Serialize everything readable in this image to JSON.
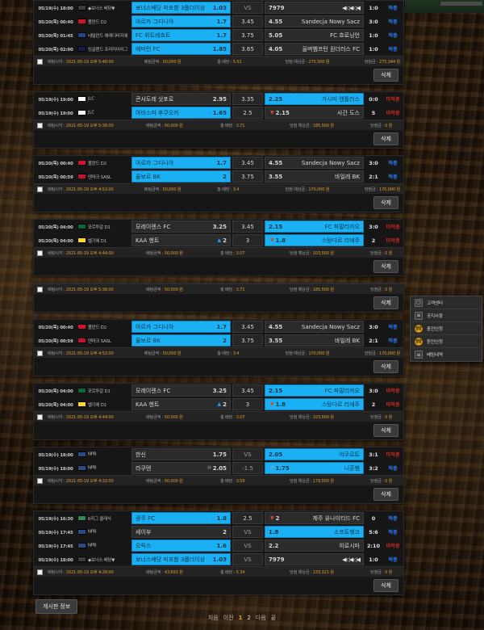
{
  "colors": {
    "selected": "#1ab0f3",
    "win": "#2f7cff",
    "lose": "#d0271b",
    "accent": "#d99c2b",
    "panel": "#161616"
  },
  "labels": {
    "delete": "삭제",
    "board_info": "게시판 정보",
    "vs": "VS",
    "bet_time": "배팅시각",
    "bet_amount": "배팅금액",
    "total_odds": "총 배당",
    "expected": "당첨 예상금",
    "payout": "당첨금",
    "win": "적중",
    "lose": "미적중"
  },
  "quick_menu": [
    {
      "icon": "chat-icon",
      "glyph": "▢",
      "label": "고객센터",
      "kind": "box"
    },
    {
      "icon": "notice-icon",
      "glyph": "≡",
      "label": "공지사항",
      "kind": "box"
    },
    {
      "icon": "deposit-icon",
      "glyph": "₩",
      "label": "충전신청",
      "kind": "coin"
    },
    {
      "icon": "withdraw-icon",
      "glyph": "₩",
      "label": "환전신청",
      "kind": "coin"
    },
    {
      "icon": "history-icon",
      "glyph": "≡",
      "label": "베팅내역",
      "kind": "box"
    }
  ],
  "pagination": {
    "first": "처음",
    "prev": "이전",
    "pages": [
      "1",
      "2"
    ],
    "current": "1",
    "next": "다음",
    "last": "끝"
  },
  "slips": [
    {
      "info": {
        "time": "배팅시각 : 2021-05-19 오후 5:46:00",
        "amount": "배팅금액 : 50,000 원",
        "odds": "총 배당 : 5.51",
        "expected": "당첨 예상금 : 275,500 원",
        "payout": "당첨금 : 275,344 원"
      },
      "legs": [
        {
          "date": "05/19(수) 18:00",
          "league": "◆보너스 배당▼",
          "flag": "#3c3c3c",
          "home": "보너스배당 미포함 3폴더이상",
          "home_odds": "1.03",
          "home_sel": true,
          "home_mark": "",
          "draw": "VS",
          "draw_plain": true,
          "away": "",
          "away_odds": "7979",
          "away_sel": false,
          "away_mark": "",
          "away_bars": true,
          "score": "1:0",
          "result": "적중",
          "won": true
        },
        {
          "date": "05/20(목) 00:40",
          "league": "폴란드 D2",
          "flag": "#d8112a",
          "home": "아르카 그디니아",
          "home_odds": "1.7",
          "home_sel": true,
          "home_mark": "",
          "draw": "3.45",
          "draw_plain": false,
          "away": "Sandecja Nowy Sacz",
          "away_odds": "4.55",
          "away_sel": false,
          "away_mark": "",
          "score": "3:0",
          "result": "적중",
          "won": true
        },
        {
          "date": "05/20(목) 01:45",
          "league": "네덜란드 에레디비지에",
          "flag": "#21468b",
          "home": "FC 위트레흐트",
          "home_odds": "1.7",
          "home_sel": true,
          "home_mark": "",
          "draw": "3.75",
          "draw_plain": false,
          "away": "FC 흐로닝언",
          "away_odds": "5.05",
          "away_sel": false,
          "away_mark": "",
          "score": "1:0",
          "result": "적중",
          "won": true
        },
        {
          "date": "05/20(목) 02:00",
          "league": "잉글랜드 프리미어리그",
          "flag": "#1a1a4a",
          "home": "에버턴 FC",
          "home_odds": "1.85",
          "home_sel": true,
          "home_mark": "",
          "draw": "3.65",
          "draw_plain": false,
          "away": "울버햄프턴 원더러스 FC",
          "away_odds": "4.05",
          "away_sel": false,
          "away_mark": "",
          "score": "1:0",
          "result": "적중",
          "won": true
        }
      ]
    },
    {
      "info": {
        "time": "배팅시각 : 2021-05-19 오후 5:36:00",
        "amount": "배팅금액 : 50,000 원",
        "odds": "총 배당 : 3.71",
        "expected": "당첨 예상금 : 185,500 원",
        "payout": "당첨금 : 0 원"
      },
      "legs": [
        {
          "date": "05/19(수) 19:00",
          "league": "JLC",
          "flag": "#ffffff",
          "home": "콘사도레 삿포로",
          "home_odds": "2.95",
          "home_sel": false,
          "home_mark": "",
          "draw": "3.35",
          "draw_plain": false,
          "away": "가시마 앤틀러스",
          "away_odds": "2.25",
          "away_sel": true,
          "away_mark": "",
          "score": "0:0",
          "result": "미적중",
          "won": false
        },
        {
          "date": "05/19(수) 19:00",
          "league": "JLC",
          "flag": "#ffffff",
          "home": "아비스파 후쿠오카",
          "home_odds": "1.65",
          "home_sel": true,
          "home_mark": "up",
          "draw": "2.5",
          "draw_plain": false,
          "away": "사간 도스",
          "away_odds": "2.15",
          "away_sel": false,
          "away_mark": "down",
          "score": "5",
          "result": "미적중",
          "won": false
        }
      ]
    },
    {
      "info": {
        "time": "배팅시각 : 2021-05-19 오후 4:52:00",
        "amount": "배팅금액 : 50,000 원",
        "odds": "총 배당 : 3.4",
        "expected": "당첨 예상금 : 170,000 원",
        "payout": "당첨금 : 170,000 원"
      },
      "legs": [
        {
          "date": "05/20(목) 00:40",
          "league": "폴란드 D2",
          "flag": "#d8112a",
          "home": "아르카 그디니아",
          "home_odds": "1.7",
          "home_sel": true,
          "home_mark": "",
          "draw": "3.45",
          "draw_plain": false,
          "away": "Sandecja Nowy Sacz",
          "away_odds": "4.55",
          "away_sel": false,
          "away_mark": "",
          "score": "3:0",
          "result": "적중",
          "won": true
        },
        {
          "date": "05/20(목) 00:59",
          "league": "덴마크 SASL",
          "flag": "#c8102e",
          "home": "올보르 BK",
          "home_odds": "2",
          "home_sel": true,
          "home_mark": "",
          "draw": "3.75",
          "draw_plain": false,
          "away": "바일레 BK",
          "away_odds": "3.55",
          "away_sel": false,
          "away_mark": "",
          "score": "2:1",
          "result": "적중",
          "won": true
        }
      ]
    },
    {
      "info": {
        "time": "배팅시각 : 2021-05-19 오후 4:44:00",
        "amount": "배팅금액 : 50,000 원",
        "odds": "총 배당 : 3.07",
        "expected": "당첨 예상금 : 103,500 원",
        "payout": "당첨금 : 0 원"
      },
      "legs": [
        {
          "date": "05/20(목) 04:00",
          "league": "포르투갈 D1",
          "flag": "#046a38",
          "home": "모레이렌스 FC",
          "home_odds": "3.25",
          "home_sel": false,
          "home_mark": "",
          "draw": "3.45",
          "draw_plain": false,
          "away": "FC 파말리카오",
          "away_odds": "2.15",
          "away_sel": true,
          "away_mark": "",
          "score": "3:0",
          "result": "미적중",
          "won": false
        },
        {
          "date": "05/20(목) 04:00",
          "league": "벨기에 D1",
          "flag": "#fdda25",
          "home": "KAA 헨트",
          "home_odds": "2",
          "home_sel": false,
          "home_mark": "up",
          "draw": "3",
          "draw_plain": false,
          "away": "스탕다르 리에주",
          "away_odds": "1.8",
          "away_sel": true,
          "away_mark": "down",
          "score": "2",
          "result": "미적중",
          "won": false
        }
      ]
    },
    {
      "info": {
        "time": "배팅시각 : 2021-05-19 오후 5:36:00",
        "amount": "배팅금액 : 50,000 원",
        "odds": "총 배당 : 3.71",
        "expected": "당첨 예상금 : 185,500 원",
        "payout": "당첨금 : 0 원"
      },
      "legs": []
    },
    {
      "info": {
        "time": "배팅시각 : 2021-05-19 오후 4:52:00",
        "amount": "배팅금액 : 50,000 원",
        "odds": "총 배당 : 3.4",
        "expected": "당첨 예상금 : 170,000 원",
        "payout": "당첨금 : 170,000 원"
      },
      "legs": [
        {
          "date": "05/20(목) 00:40",
          "league": "폴란드 D2",
          "flag": "#d8112a",
          "home": "아르카 그디니아",
          "home_odds": "1.7",
          "home_sel": true,
          "home_mark": "",
          "draw": "3.45",
          "draw_plain": false,
          "away": "Sandecja Nowy Sacz",
          "away_odds": "4.55",
          "away_sel": false,
          "away_mark": "",
          "score": "3:0",
          "result": "적중",
          "won": true
        },
        {
          "date": "05/20(목) 00:59",
          "league": "덴마크 SASL",
          "flag": "#c8102e",
          "home": "올보르 BK",
          "home_odds": "2",
          "home_sel": true,
          "home_mark": "",
          "draw": "3.75",
          "draw_plain": false,
          "away": "바일레 BK",
          "away_odds": "3.55",
          "away_sel": false,
          "away_mark": "",
          "score": "2:1",
          "result": "적중",
          "won": true
        }
      ]
    },
    {
      "info": {
        "time": "배팅시각 : 2021-05-19 오후 4:44:00",
        "amount": "배팅금액 : 50,000 원",
        "odds": "총 배당 : 3.07",
        "expected": "당첨 예상금 : 103,500 원",
        "payout": "당첨금 : 0 원"
      },
      "legs": [
        {
          "date": "05/20(목) 04:00",
          "league": "포르투갈 D1",
          "flag": "#046a38",
          "home": "모레이렌스 FC",
          "home_odds": "3.25",
          "home_sel": false,
          "home_mark": "",
          "draw": "3.45",
          "draw_plain": false,
          "away": "FC 파말리카오",
          "away_odds": "2.15",
          "away_sel": true,
          "away_mark": "",
          "score": "3:0",
          "result": "미적중",
          "won": false
        },
        {
          "date": "05/20(목) 04:00",
          "league": "벨기에 D1",
          "flag": "#fdda25",
          "home": "KAA 헨트",
          "home_odds": "2",
          "home_sel": false,
          "home_mark": "up",
          "draw": "3",
          "draw_plain": false,
          "away": "스탕다르 리에주",
          "away_odds": "1.8",
          "away_sel": true,
          "away_mark": "down",
          "score": "2",
          "result": "미적중",
          "won": false
        }
      ]
    },
    {
      "info": {
        "time": "배팅시각 : 2021-05-19 오후 4:32:00",
        "amount": "배팅금액 : 50,000 원",
        "odds": "총 배당 : 3.59",
        "expected": "당첨 예상금 : 179,500 원",
        "payout": "당첨금 : 0 원"
      },
      "legs": [
        {
          "date": "05/19(수) 18:00",
          "league": "NPB",
          "flag": "#2a4a8a",
          "home": "한신",
          "home_odds": "1.75",
          "home_sel": false,
          "home_mark": "",
          "draw": "VS",
          "draw_plain": true,
          "away": "야쿠르트",
          "away_odds": "2.05",
          "away_sel": true,
          "away_mark": "",
          "score": "3:1",
          "result": "미적중",
          "won": false
        },
        {
          "date": "05/19(수) 18:00",
          "league": "NPB",
          "flag": "#2a4a8a",
          "home": "라쿠텐",
          "home_odds": "2.05",
          "home_sel": false,
          "home_mark": "",
          "home_hcap": "H",
          "draw": "-1.5",
          "draw_plain": true,
          "away": "니혼햄",
          "away_odds": "1.75",
          "away_sel": true,
          "away_mark": "",
          "away_hcap": "H",
          "score": "3:2",
          "result": "적중",
          "won": true
        }
      ]
    },
    {
      "info": {
        "time": "배팅시각 : 2021-05-19 오후 4:28:00",
        "amount": "배팅금액 : 43,693 원",
        "odds": "총 배당 : 5.34",
        "expected": "당첨 예상금 : 233,321 원",
        "payout": "당첨금 : 0 원"
      },
      "legs": [
        {
          "date": "05/19(수) 16:30",
          "league": "K리그 클래식",
          "flag": "#2e8b57",
          "home": "광주 FC",
          "home_odds": "1.8",
          "home_sel": true,
          "home_mark": "up",
          "draw": "2.5",
          "draw_plain": false,
          "away": "제주 유나이티드 FC",
          "away_odds": "2",
          "away_sel": false,
          "away_mark": "down",
          "score": "0",
          "result": "적중",
          "won": true
        },
        {
          "date": "05/19(수) 17:45",
          "league": "NPB",
          "flag": "#2a4a8a",
          "home": "세이부",
          "home_odds": "2",
          "home_sel": false,
          "home_mark": "",
          "draw": "VS",
          "draw_plain": true,
          "away": "소프트뱅크",
          "away_odds": "1.8",
          "away_sel": true,
          "away_mark": "",
          "score": "5:6",
          "result": "적중",
          "won": true
        },
        {
          "date": "05/19(수) 17:45",
          "league": "NPB",
          "flag": "#2a4a8a",
          "home": "오릭스",
          "home_odds": "1.6",
          "home_sel": true,
          "home_mark": "",
          "draw": "VS",
          "draw_plain": true,
          "away": "히로시마",
          "away_odds": "2.2",
          "away_sel": false,
          "away_mark": "",
          "score": "2:10",
          "result": "미적중",
          "won": false
        },
        {
          "date": "05/19(수) 18:00",
          "league": "◆보너스 배당▼",
          "flag": "#3c3c3c",
          "home": "보너스배당 미포함 3폴더이상",
          "home_odds": "1.03",
          "home_sel": true,
          "home_mark": "",
          "draw": "VS",
          "draw_plain": true,
          "away": "",
          "away_odds": "7979",
          "away_sel": false,
          "away_mark": "",
          "away_bars": true,
          "score": "1:0",
          "result": "적중",
          "won": true
        }
      ]
    }
  ]
}
